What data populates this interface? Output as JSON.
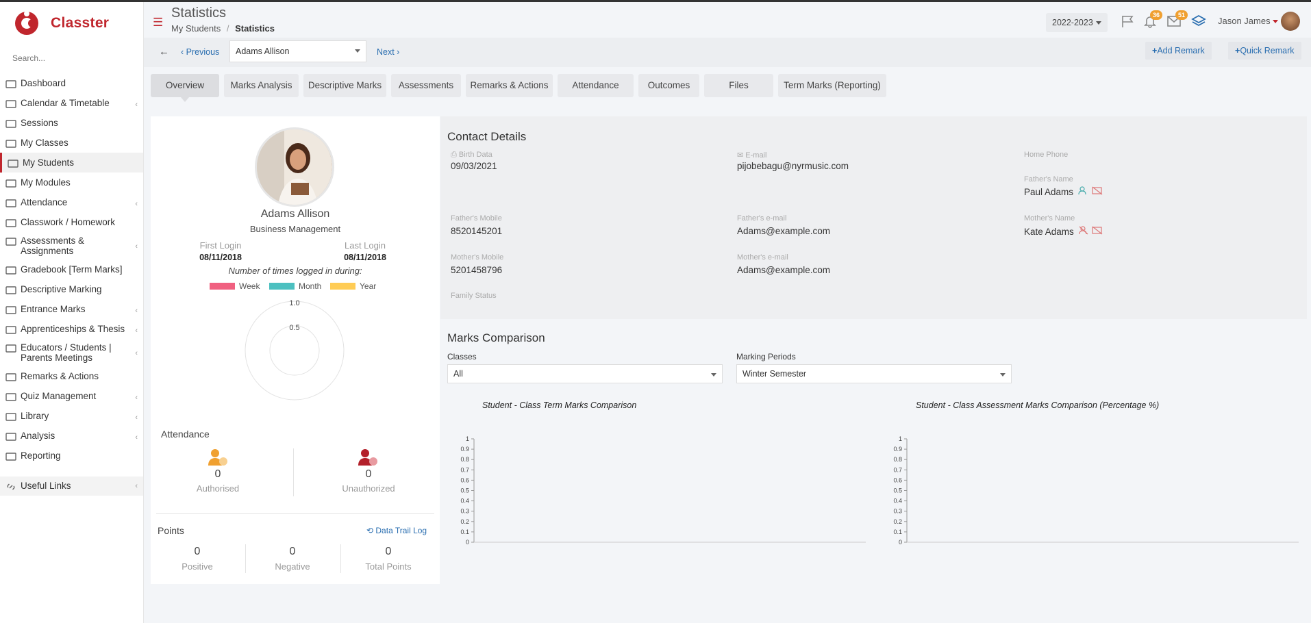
{
  "app": {
    "name": "Classter"
  },
  "sidebar": {
    "search_placeholder": "Search...",
    "items": [
      {
        "label": "Dashboard",
        "chevron": false
      },
      {
        "label": "Calendar & Timetable",
        "chevron": true
      },
      {
        "label": "Sessions",
        "chevron": false
      },
      {
        "label": "My Classes",
        "chevron": false
      },
      {
        "label": "My Students",
        "chevron": false,
        "active": true
      },
      {
        "label": "My Modules",
        "chevron": false
      },
      {
        "label": "Attendance",
        "chevron": true
      },
      {
        "label": "Classwork / Homework",
        "chevron": false
      },
      {
        "label": "Assessments & Assignments",
        "chevron": true
      },
      {
        "label": "Gradebook [Term Marks]",
        "chevron": false
      },
      {
        "label": "Descriptive Marking",
        "chevron": false
      },
      {
        "label": "Entrance Marks",
        "chevron": true
      },
      {
        "label": "Apprenticeships & Thesis",
        "chevron": true
      },
      {
        "label": "Educators / Students | Parents Meetings",
        "chevron": true
      },
      {
        "label": "Remarks & Actions",
        "chevron": false
      },
      {
        "label": "Quiz Management",
        "chevron": true
      },
      {
        "label": "Library",
        "chevron": true
      },
      {
        "label": "Analysis",
        "chevron": true
      },
      {
        "label": "Reporting",
        "chevron": false
      }
    ],
    "useful_links": "Useful Links"
  },
  "header": {
    "title": "Statistics",
    "breadcrumb": {
      "parent": "My Students",
      "separator": "/",
      "current": "Statistics"
    },
    "year": "2022-2023",
    "notifications_count": "36",
    "messages_count": "51",
    "user_name": "Jason James"
  },
  "toolbar": {
    "previous": "Previous",
    "student_select": "Adams Allison",
    "next": "Next",
    "add_remark": "Add Remark",
    "quick_remark": "Quick Remark"
  },
  "tabs": [
    "Overview",
    "Marks Analysis",
    "Descriptive Marks",
    "Assessments",
    "Remarks & Actions",
    "Attendance",
    "Outcomes",
    "Files",
    "Term Marks (Reporting)"
  ],
  "profile": {
    "name": "Adams Allison",
    "program": "Business Management",
    "first_login_label": "First Login",
    "first_login": "08/11/2018",
    "last_login_label": "Last Login",
    "last_login": "08/11/2018",
    "logged_caption": "Number of times logged in during:",
    "legend": [
      {
        "label": "Week",
        "color": "#f06080"
      },
      {
        "label": "Month",
        "color": "#4cc0c0"
      },
      {
        "label": "Year",
        "color": "#ffcc55"
      }
    ],
    "radar_ticks": [
      "1.0",
      "0.5"
    ]
  },
  "attendance": {
    "title": "Attendance",
    "authorised": "0",
    "authorised_label": "Authorised",
    "unauthorized": "0",
    "unauthorized_label": "Unauthorized"
  },
  "points": {
    "title": "Points",
    "data_trail": "Data Trail Log",
    "positive": "0",
    "positive_label": "Positive",
    "negative": "0",
    "negative_label": "Negative",
    "total": "0",
    "total_label": "Total Points"
  },
  "contact": {
    "title": "Contact Details",
    "birth_label": "Birth Data",
    "birth": "09/03/2021",
    "email_label": "E-mail",
    "email": "pijobebagu@nyrmusic.com",
    "home_phone_label": "Home Phone",
    "father_name_label": "Father's Name",
    "father_name": "Paul Adams",
    "father_mobile_label": "Father's Mobile",
    "father_mobile": "8520145201",
    "father_email_label": "Father's e-mail",
    "father_email": "Adams@example.com",
    "mother_name_label": "Mother's Name",
    "mother_name": "Kate Adams",
    "mother_mobile_label": "Mother's Mobile",
    "mother_mobile": "5201458796",
    "mother_email_label": "Mother's e-mail",
    "mother_email": "Adams@example.com",
    "family_status_label": "Family Status"
  },
  "marks_comparison": {
    "title": "Marks Comparison",
    "classes_label": "Classes",
    "classes_value": "All",
    "periods_label": "Marking Periods",
    "periods_value": "Winter Semester"
  },
  "chart_data": [
    {
      "type": "bar",
      "title": "Student - Class Term Marks Comparison",
      "categories": [],
      "values": [],
      "ylim": [
        0,
        1
      ],
      "yticks": [
        "1",
        "0.9",
        "0.8",
        "0.7",
        "0.6",
        "0.5",
        "0.4",
        "0.3",
        "0.2",
        "0.1",
        "0"
      ]
    },
    {
      "type": "bar",
      "title": "Student - Class Assessment Marks Comparison (Percentage %)",
      "categories": [],
      "values": [],
      "ylim": [
        0,
        1
      ],
      "yticks": [
        "1",
        "0.9",
        "0.8",
        "0.7",
        "0.6",
        "0.5",
        "0.4",
        "0.3",
        "0.2",
        "0.1",
        "0"
      ]
    }
  ]
}
